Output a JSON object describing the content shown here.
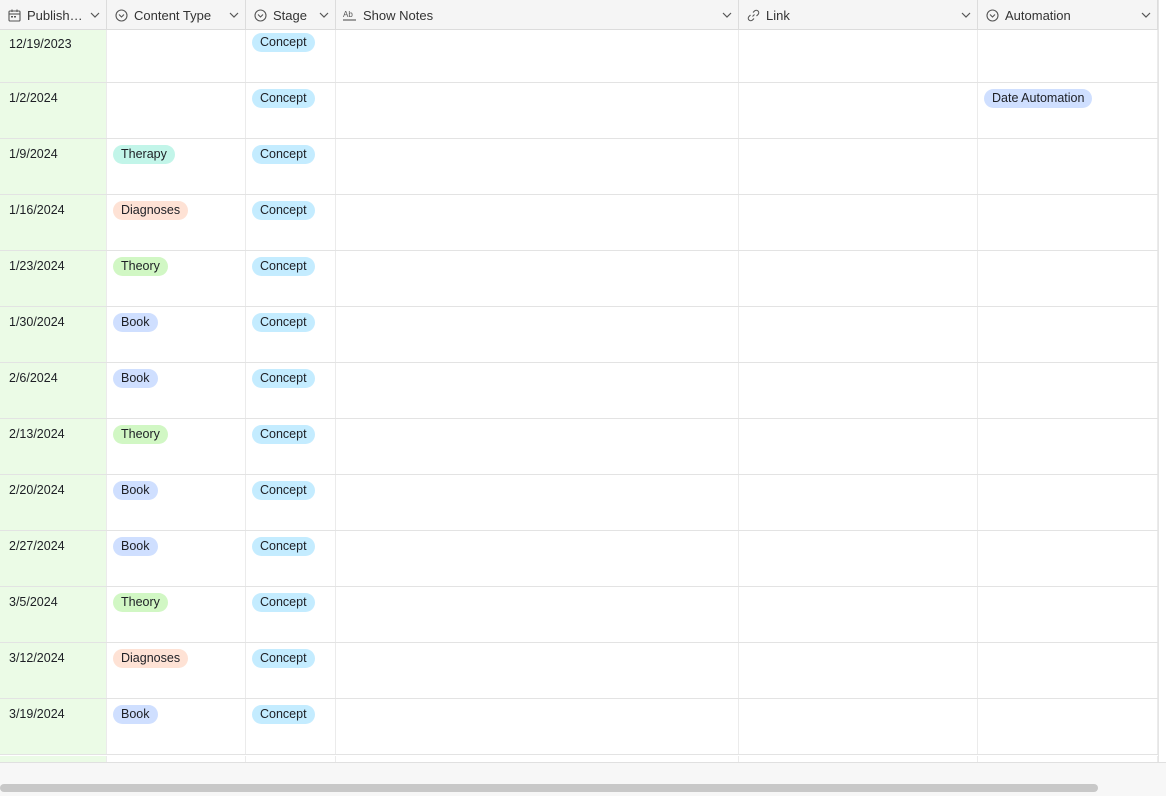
{
  "columns": [
    {
      "label": "Publish ...",
      "icon": "calendar-icon"
    },
    {
      "label": "Content Type",
      "icon": "single-select-icon"
    },
    {
      "label": "Stage",
      "icon": "single-select-icon"
    },
    {
      "label": "Show Notes",
      "icon": "long-text-icon"
    },
    {
      "label": "Link",
      "icon": "link-icon"
    },
    {
      "label": "Automation",
      "icon": "single-select-icon"
    }
  ],
  "colors": {
    "Concept": "#c4ecff",
    "Therapy": "#c2f5e9",
    "Diagnoses": "#fee2d5",
    "Theory": "#d1f7c4",
    "Book": "#cfdfff",
    "Date Automation": "#cfdfff",
    "date_column_bg": "#ebfbe6"
  },
  "rows": [
    {
      "date": "12/19/2023",
      "content_type": "",
      "stage": "Concept",
      "show_notes": "",
      "link": "",
      "automation": ""
    },
    {
      "date": "1/2/2024",
      "content_type": "",
      "stage": "Concept",
      "show_notes": "",
      "link": "",
      "automation": "Date Automation"
    },
    {
      "date": "1/9/2024",
      "content_type": "Therapy",
      "stage": "Concept",
      "show_notes": "",
      "link": "",
      "automation": ""
    },
    {
      "date": "1/16/2024",
      "content_type": "Diagnoses",
      "stage": "Concept",
      "show_notes": "",
      "link": "",
      "automation": ""
    },
    {
      "date": "1/23/2024",
      "content_type": "Theory",
      "stage": "Concept",
      "show_notes": "",
      "link": "",
      "automation": ""
    },
    {
      "date": "1/30/2024",
      "content_type": "Book",
      "stage": "Concept",
      "show_notes": "",
      "link": "",
      "automation": ""
    },
    {
      "date": "2/6/2024",
      "content_type": "Book",
      "stage": "Concept",
      "show_notes": "",
      "link": "",
      "automation": ""
    },
    {
      "date": "2/13/2024",
      "content_type": "Theory",
      "stage": "Concept",
      "show_notes": "",
      "link": "",
      "automation": ""
    },
    {
      "date": "2/20/2024",
      "content_type": "Book",
      "stage": "Concept",
      "show_notes": "",
      "link": "",
      "automation": ""
    },
    {
      "date": "2/27/2024",
      "content_type": "Book",
      "stage": "Concept",
      "show_notes": "",
      "link": "",
      "automation": ""
    },
    {
      "date": "3/5/2024",
      "content_type": "Theory",
      "stage": "Concept",
      "show_notes": "",
      "link": "",
      "automation": ""
    },
    {
      "date": "3/12/2024",
      "content_type": "Diagnoses",
      "stage": "Concept",
      "show_notes": "",
      "link": "",
      "automation": ""
    },
    {
      "date": "3/19/2024",
      "content_type": "Book",
      "stage": "Concept",
      "show_notes": "",
      "link": "",
      "automation": ""
    }
  ],
  "partial_row": {
    "content_type_color": "#ffdce5",
    "stage_color": "#c4ecff"
  }
}
